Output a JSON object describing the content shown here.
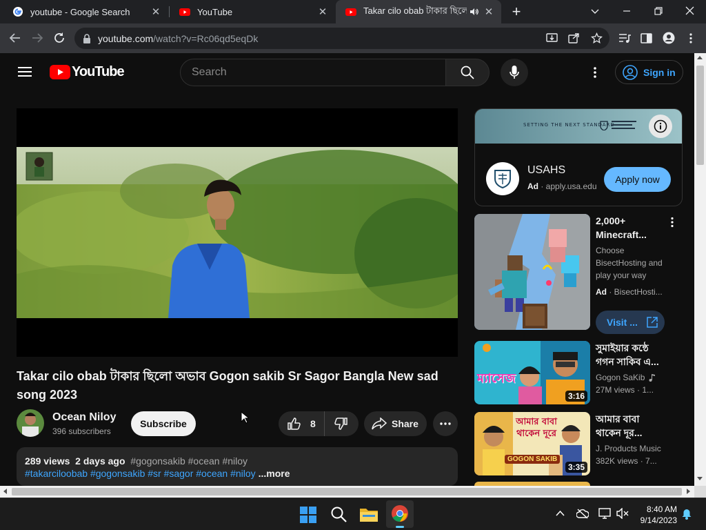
{
  "browser": {
    "tabs": [
      {
        "title": "youtube - Google Search"
      },
      {
        "title": "YouTube"
      },
      {
        "title": "Takar cilo obab টাকার ছিলো অভাব Gogon sakib"
      }
    ],
    "url_host": "youtube.com",
    "url_path": "/watch?v=Rc06qd5eqDk"
  },
  "youtube": {
    "logo_text": "YouTube",
    "search_placeholder": "Search",
    "sign_in": "Sign in"
  },
  "video": {
    "title": "Takar cilo obab টাকার ছিলো অভাব Gogon sakib Sr Sagor Bangla New sad song 2023",
    "channel": "Ocean Niloy",
    "subscribers": "396 subscribers",
    "subscribe": "Subscribe",
    "likes": "8",
    "share": "Share",
    "views": "289 views",
    "age": "2 days ago",
    "desc_tags_line1": "#gogonsakib #ocean #niloy",
    "desc_tags_line2": "#takarciloobab #gogonsakib #sr #sagor #ocean #niloy",
    "more": "...more"
  },
  "ad_banner": {
    "banner_text": "SETTING THE NEXT STANDARD",
    "advertiser": "USAHS",
    "ad_label": "Ad",
    "domain": "apply.usa.edu",
    "cta": "Apply now"
  },
  "sidebar": [
    {
      "title_line1": "2,000+",
      "title_line2": "Minecraft...",
      "desc_line1": "Choose",
      "desc_line2": "BisectHosting and",
      "desc_line3": "play your way",
      "ad_label": "Ad",
      "advertiser": "BisectHosti...",
      "cta": "Visit ..."
    },
    {
      "title_line1": "সুমাইয়ার কন্ঠে",
      "title_line2": "গগন সাকিব এ...",
      "channel": "Gogon SaKib",
      "meta": "27M views · 1...",
      "duration": "3:16",
      "thumb_caption": "ম্যাসেজ"
    },
    {
      "title_line1": "আমার বাবা",
      "title_line2": "থাকেন দূর...",
      "channel": "J. Products Music",
      "meta": "382K views · 7...",
      "duration": "3:35",
      "thumb_caption": "আমার বাবা থাকেন দূরে",
      "thumb_subcaption": "GOGON SAKIB"
    }
  ],
  "taskbar": {
    "time": "8:40 AM",
    "date": "9/14/2023"
  },
  "colors": {
    "yt_red": "#ff0000",
    "link_blue": "#3ea6ff",
    "apply_blue": "#65b8ff"
  }
}
